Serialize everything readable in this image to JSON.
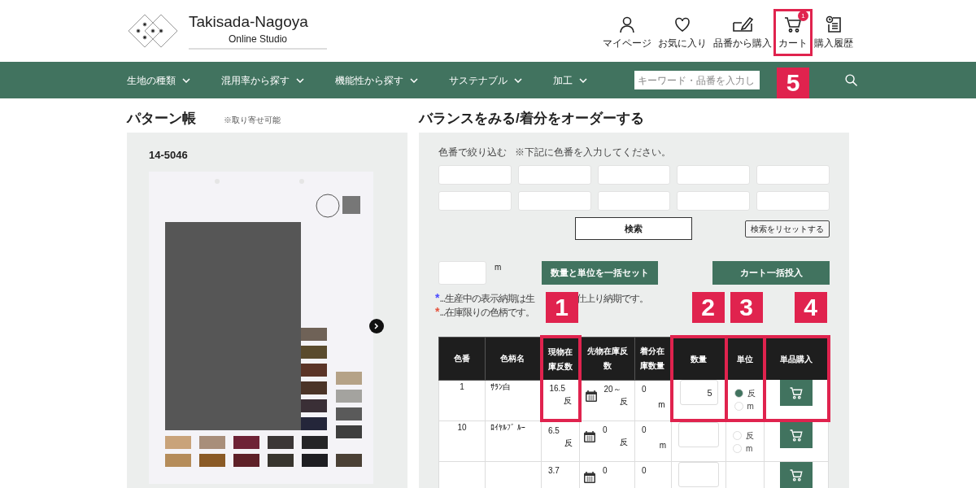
{
  "logo": {
    "name": "Takisada-Nagoya",
    "sub": "Online Studio"
  },
  "header_icons": [
    {
      "kind": "user",
      "label": "マイページ"
    },
    {
      "kind": "heart",
      "label": "お気に入り"
    },
    {
      "kind": "pen",
      "label": "品番から購入"
    },
    {
      "kind": "cart",
      "label": "カート",
      "badge": "1",
      "callout": "5"
    },
    {
      "kind": "history",
      "label": "購入履歴"
    }
  ],
  "nav": {
    "items": [
      "生地の種類",
      "混用率から探す",
      "機能性から探す",
      "サステナブル",
      "加工"
    ],
    "search": {
      "placeholder": "キーワード・品番を入力し"
    }
  },
  "pattern_book": {
    "title": "パターン帳",
    "note": "※取り寄せ可能",
    "code": "14-5046"
  },
  "order": {
    "title": "バランスをみる/着分をオーダーする",
    "filter_label": "色番で絞り込む",
    "filter_note": "※下記に色番を入力してください。",
    "search_button": "検索",
    "reset_button": "検索をリセットする",
    "unit_label": "m",
    "set_button": "数量と単位を一括セット",
    "cart_all_button": "カート一括投入",
    "notes": [
      {
        "mark": "*",
        "color": "#4a4aff",
        "parts": [
          "...生産中の表示納期は生",
          "仕上り納期です。"
        ]
      },
      {
        "mark": "*",
        "color": "#e5533d",
        "parts": [
          "...在庫限りの色柄です。"
        ]
      }
    ]
  },
  "table": {
    "columns": [
      {
        "label": "色番",
        "highlighted": false
      },
      {
        "label": "色柄名",
        "highlighted": false
      },
      {
        "label": "現物在庫反数",
        "highlighted": true,
        "callout": "1"
      },
      {
        "label": "先物在庫反数",
        "highlighted": false
      },
      {
        "label": "着分在庫数量",
        "highlighted": false
      },
      {
        "label": "数量",
        "highlighted": true,
        "callout": "2"
      },
      {
        "label": "単位",
        "highlighted": true,
        "callout": "3"
      },
      {
        "label": "単品購入",
        "highlighted": true,
        "callout": "4"
      }
    ],
    "rows": [
      {
        "no": "1",
        "name": "ｻﾗﾝ白",
        "stock": "16.5",
        "stock_unit": "反",
        "future": "20～",
        "future_unit": "反",
        "cut": "0",
        "cut_unit": "m",
        "qty": "5",
        "units": [
          {
            "label": "反",
            "selected": true
          },
          {
            "label": "m",
            "selected": false
          }
        ]
      },
      {
        "no": "10",
        "name": "ﾛｲﾔﾙﾌﾞ ﾙｰ",
        "stock": "6.5",
        "stock_unit": "反",
        "future": "0",
        "future_unit": "反",
        "cut": "0",
        "cut_unit": "m",
        "units": [
          {
            "label": "反",
            "selected": false
          },
          {
            "label": "m",
            "selected": false
          }
        ]
      },
      {
        "stock": "3.7",
        "future": "0",
        "cut": "0"
      }
    ]
  }
}
